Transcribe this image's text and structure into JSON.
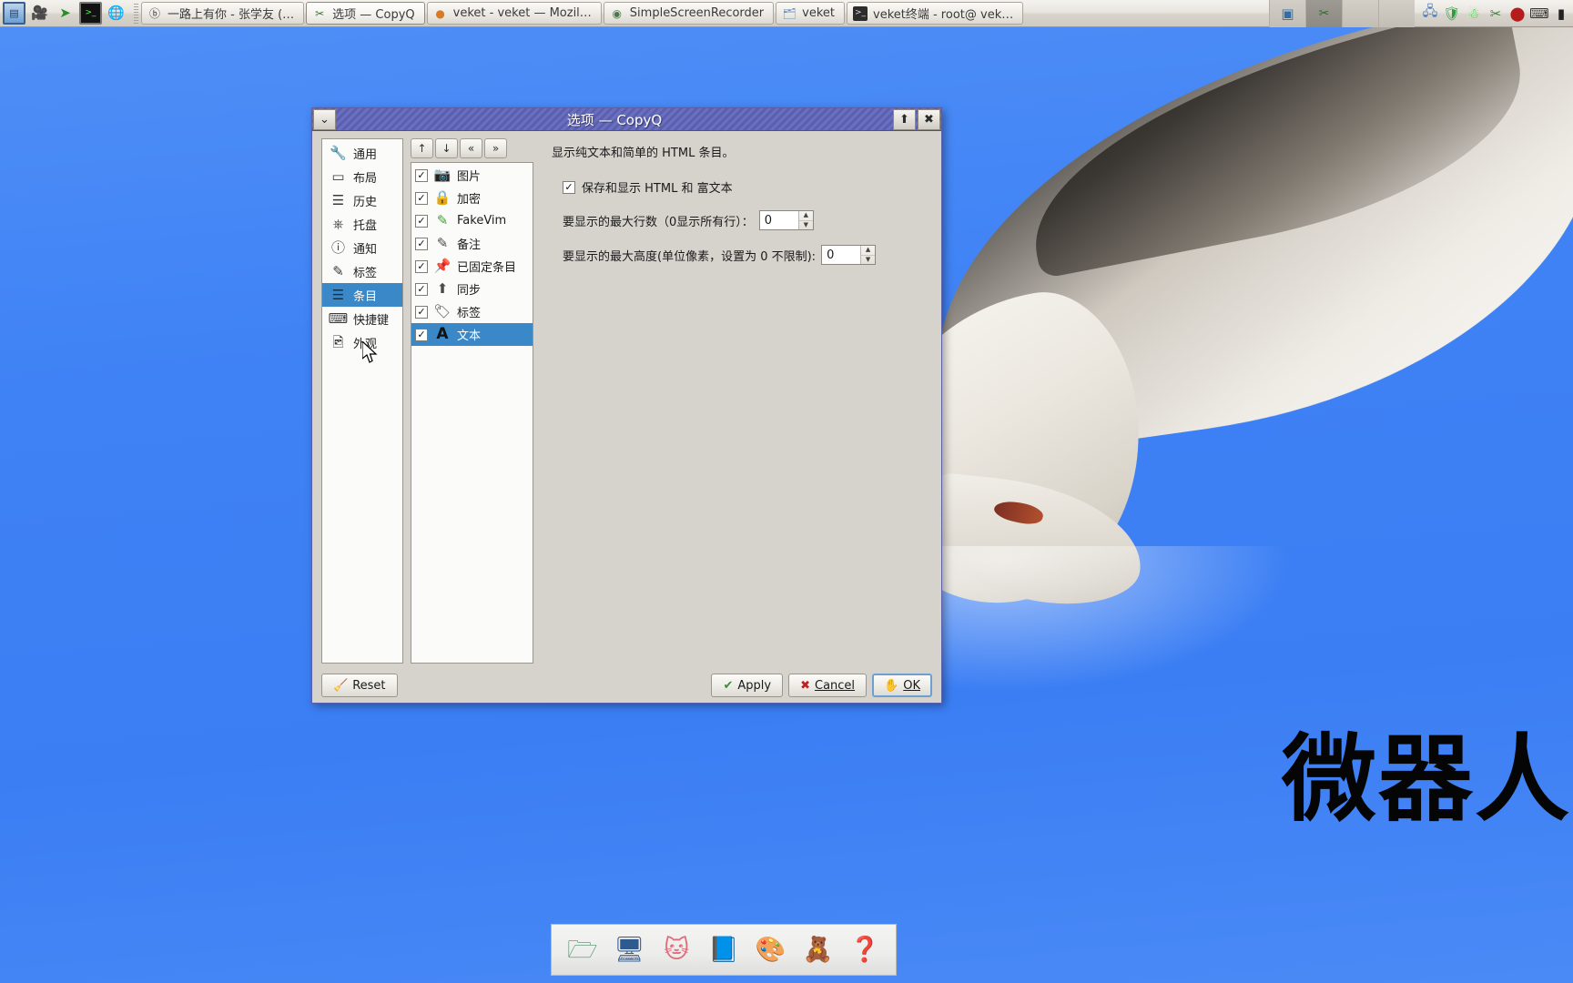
{
  "taskbar": {
    "launchers": [
      {
        "name": "system-monitor-icon",
        "glyph": "☷"
      },
      {
        "name": "video-camera-icon",
        "glyph": "🎥"
      },
      {
        "name": "media-play-icon",
        "glyph": "➤"
      },
      {
        "name": "terminal-icon",
        "glyph": ">_"
      },
      {
        "name": "web-browser-icon",
        "glyph": "🌐"
      }
    ],
    "tasks": [
      {
        "icon": "audio-player-icon",
        "glyph": "ⓐ",
        "label": "一路上有你 - 张学友 (…",
        "active": false
      },
      {
        "icon": "copyq-icon",
        "glyph": "✂",
        "label": "选项 — CopyQ",
        "active": true
      },
      {
        "icon": "firefox-icon",
        "glyph": "🦊",
        "label": "veket - veket — Mozil…",
        "active": false
      },
      {
        "icon": "screenrecorder-icon",
        "glyph": "◉",
        "label": "SimpleScreenRecorder",
        "active": false
      },
      {
        "icon": "folder-icon",
        "glyph": "🗀",
        "label": "veket",
        "active": false
      },
      {
        "icon": "terminal-window-icon",
        "glyph": "▣",
        "label": "veket终端 - root@ vek…",
        "active": false
      }
    ],
    "tray_slots": [
      {
        "name": "pager-desktop-1",
        "glyph": "❖",
        "selected": false
      },
      {
        "name": "pager-desktop-2",
        "glyph": "✂",
        "selected": true
      },
      {
        "name": "pager-desktop-3",
        "glyph": "",
        "selected": false
      },
      {
        "name": "pager-desktop-4",
        "glyph": "",
        "selected": false
      }
    ],
    "tray_icons": [
      {
        "name": "network-icon",
        "glyph": "🖧"
      },
      {
        "name": "shield-icon",
        "glyph": "🛡"
      },
      {
        "name": "disk-icon",
        "glyph": "⛃"
      },
      {
        "name": "copyq-tray-icon",
        "glyph": "✂"
      },
      {
        "name": "record-icon",
        "glyph": "⬤"
      },
      {
        "name": "keyboard-icon",
        "glyph": "⌨"
      },
      {
        "name": "battery-icon",
        "glyph": "▮"
      }
    ]
  },
  "dialog": {
    "title": "选项 — CopyQ",
    "titlebar": {
      "menu_glyph": "⌄",
      "shade_glyph": "⬆",
      "close_glyph": "✖"
    },
    "categories": [
      {
        "label": "通用",
        "icon": "wrench-icon",
        "glyph": "🔧",
        "selected": false
      },
      {
        "label": "布局",
        "icon": "layout-icon",
        "glyph": "▥",
        "selected": false
      },
      {
        "label": "历史",
        "icon": "history-icon",
        "glyph": "☰",
        "selected": false
      },
      {
        "label": "托盘",
        "icon": "tray-icon",
        "glyph": "📥",
        "selected": false
      },
      {
        "label": "通知",
        "icon": "info-icon",
        "glyph": "ℹ",
        "selected": false
      },
      {
        "label": "标签",
        "icon": "pencil-icon",
        "glyph": "✎",
        "selected": false
      },
      {
        "label": "条目",
        "icon": "items-icon",
        "glyph": "☰",
        "selected": true
      },
      {
        "label": "快捷键",
        "icon": "keyboard-icon",
        "glyph": "⌨",
        "selected": false
      },
      {
        "label": "外观",
        "icon": "image-icon",
        "glyph": "🖼",
        "selected": false
      }
    ],
    "item_toolbar": [
      {
        "name": "move-up-button",
        "glyph": "↑"
      },
      {
        "name": "move-down-button",
        "glyph": "↓"
      },
      {
        "name": "move-top-button",
        "glyph": "«"
      },
      {
        "name": "move-bottom-button",
        "glyph": "»"
      }
    ],
    "formats": [
      {
        "label": "图片",
        "icon": "camera-icon",
        "glyph": "📷",
        "checked": true,
        "selected": false
      },
      {
        "label": "加密",
        "icon": "lock-icon",
        "glyph": "🔒",
        "checked": true,
        "selected": false
      },
      {
        "label": "FakeVim",
        "icon": "fakevim-icon",
        "glyph": "✎",
        "checked": true,
        "selected": false
      },
      {
        "label": "备注",
        "icon": "note-icon",
        "glyph": "✎",
        "checked": true,
        "selected": false
      },
      {
        "label": "已固定条目",
        "icon": "pin-icon",
        "glyph": "📌",
        "checked": true,
        "selected": false
      },
      {
        "label": "同步",
        "icon": "sync-upload-icon",
        "glyph": "⬆",
        "checked": true,
        "selected": false
      },
      {
        "label": "标签",
        "icon": "tag-icon",
        "glyph": "🏷",
        "checked": true,
        "selected": false
      },
      {
        "label": "文本",
        "icon": "text-a-icon",
        "glyph": "A",
        "checked": true,
        "selected": true
      }
    ],
    "panel": {
      "description": "显示纯文本和简单的 HTML 条目。",
      "html_checkbox_label": "保存和显示 HTML 和 富文本",
      "html_checkbox_checked": true,
      "max_lines_label": "要显示的最大行数（0显示所有行）：",
      "max_lines_value": "0",
      "max_height_label": "要显示的最大高度(单位像素，设置为 0 不限制):",
      "max_height_value": "0",
      "spin_up_glyph": "▲",
      "spin_down_glyph": "▼",
      "check_glyph": "✓"
    },
    "footer": {
      "reset_label": "Reset",
      "reset_glyph": "🧹",
      "apply_label": "Apply",
      "apply_glyph": "✔",
      "cancel_label": "Cancel",
      "cancel_glyph": "✖",
      "ok_label": "OK",
      "ok_glyph": "✋"
    }
  },
  "desktop": {
    "wallpaper_text": "微器人"
  },
  "dock": {
    "items": [
      {
        "name": "file-manager-icon",
        "glyph": "🗁"
      },
      {
        "name": "display-setup-icon",
        "glyph": "🖵"
      },
      {
        "name": "firefox-cat-icon",
        "glyph": "🐱"
      },
      {
        "name": "text-editor-icon",
        "glyph": "📘"
      },
      {
        "name": "paint-palette-icon",
        "glyph": "🎨"
      },
      {
        "name": "veket-bear-icon",
        "glyph": "🧸"
      },
      {
        "name": "help-icon",
        "glyph": "❓"
      }
    ]
  }
}
